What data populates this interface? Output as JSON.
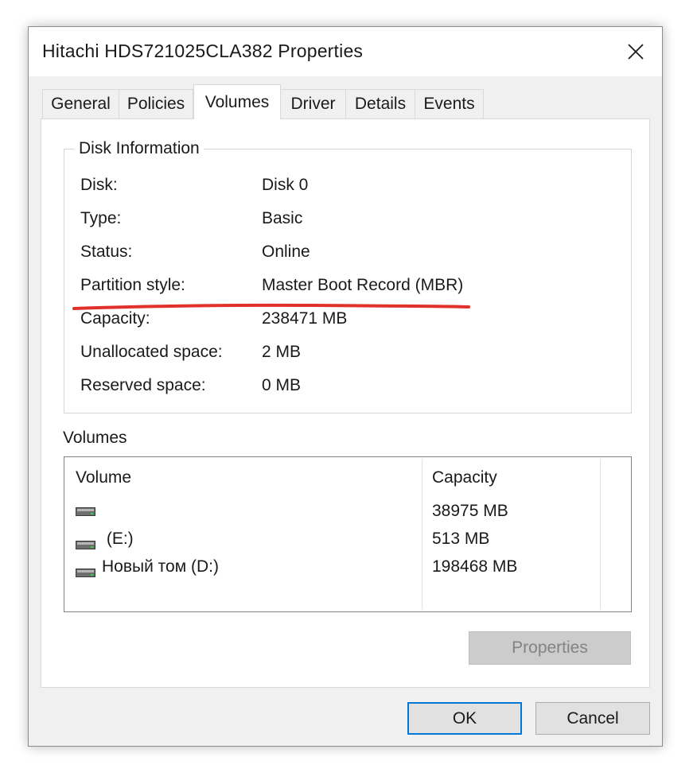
{
  "window": {
    "title": "Hitachi HDS721025CLA382 Properties"
  },
  "tabs": [
    {
      "label": "General",
      "active": false
    },
    {
      "label": "Policies",
      "active": false
    },
    {
      "label": "Volumes",
      "active": true
    },
    {
      "label": "Driver",
      "active": false
    },
    {
      "label": "Details",
      "active": false
    },
    {
      "label": "Events",
      "active": false
    }
  ],
  "disk_info": {
    "title": "Disk Information",
    "rows": [
      {
        "label": "Disk:",
        "value": "Disk 0"
      },
      {
        "label": "Type:",
        "value": "Basic"
      },
      {
        "label": "Status:",
        "value": "Online"
      },
      {
        "label": "Partition style:",
        "value": "Master Boot Record (MBR)"
      },
      {
        "label": "Capacity:",
        "value": "238471 MB"
      },
      {
        "label": "Unallocated space:",
        "value": "2 MB"
      },
      {
        "label": "Reserved space:",
        "value": "0 MB"
      }
    ],
    "highlight_color": "#e0322b"
  },
  "volumes": {
    "label": "Volumes",
    "columns": [
      "Volume",
      "Capacity"
    ],
    "rows": [
      {
        "volume": "",
        "capacity": "38975 MB",
        "icon": "drive-icon"
      },
      {
        "volume": " (E:)",
        "capacity": "513 MB",
        "icon": "drive-icon"
      },
      {
        "volume": "Новый том (D:)",
        "capacity": "198468 MB",
        "icon": "drive-icon"
      }
    ]
  },
  "buttons": {
    "properties": "Properties",
    "ok": "OK",
    "cancel": "Cancel"
  },
  "colors": {
    "accent": "#0078d7",
    "window_bg": "#f0f0f0",
    "disabled_text": "#838383"
  }
}
